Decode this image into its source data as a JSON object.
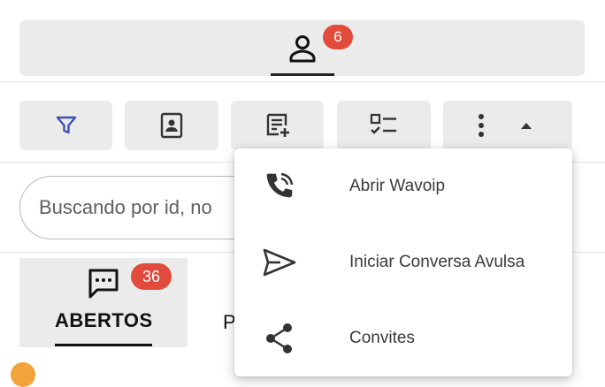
{
  "header": {
    "icon": "person-icon",
    "badge_count": "6"
  },
  "toolbar": {
    "buttons": [
      {
        "icon": "filter-icon",
        "color": "#3f51b5"
      },
      {
        "icon": "contact-card-icon"
      },
      {
        "icon": "note-add-icon"
      },
      {
        "icon": "checklist-icon"
      },
      {
        "icon": "more-vert-icon"
      },
      {
        "icon": "caret-up-icon"
      }
    ]
  },
  "search": {
    "placeholder": "Buscando por id, no"
  },
  "tabs": [
    {
      "label": "ABERTOS",
      "badge": "36",
      "icon": "chat-icon"
    },
    {
      "label": "P"
    }
  ],
  "menu": {
    "items": [
      {
        "label": "Abrir Wavoip",
        "icon": "phone-call-icon"
      },
      {
        "label": "Iniciar Conversa Avulsa",
        "icon": "send-icon"
      },
      {
        "label": "Convites",
        "icon": "share-icon"
      }
    ]
  },
  "colors": {
    "badge": "#e24b3b",
    "accent": "#3f51b5",
    "panel": "#ebebeb"
  }
}
